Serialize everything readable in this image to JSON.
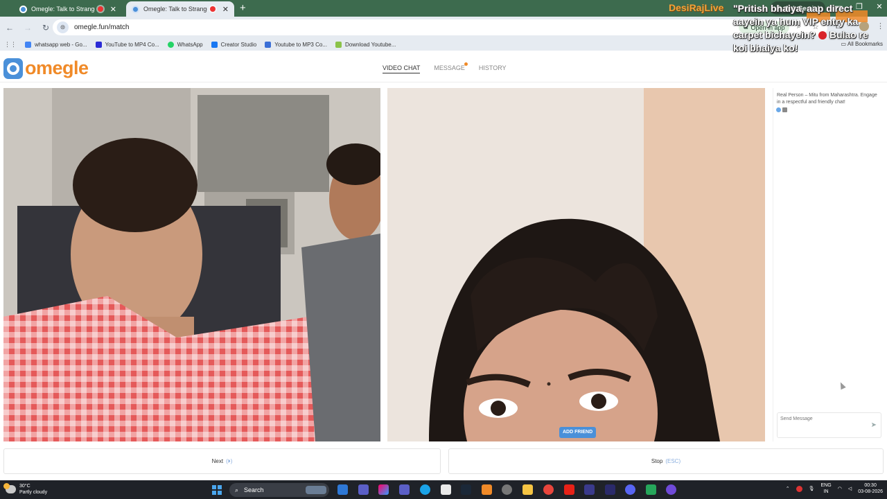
{
  "browser": {
    "tabs": [
      {
        "title": "Omegle: Talk to Strangers!",
        "recording": true,
        "active": false
      },
      {
        "title": "Omegle: Talk to Strangers!",
        "recording": true,
        "active": true
      }
    ],
    "new_tab": "+",
    "ask_gemini": "Ask Gemini",
    "url": "omegle.fun/match",
    "open_in_app": "Open in app",
    "bookmarks": [
      {
        "label": "whatsapp web - Go...",
        "color": "#4285f4"
      },
      {
        "label": "YouTube to MP4 Co...",
        "color": "#2b2bd6"
      },
      {
        "label": "WhatsApp",
        "color": "#25d366"
      },
      {
        "label": "Creator Studio",
        "color": "#1877f2"
      },
      {
        "label": "Youtube to MP3 Co...",
        "color": "#3b6fd6"
      },
      {
        "label": "Download Youtube...",
        "color": "#8bc34a"
      }
    ],
    "all_bookmarks": "All Bookmarks"
  },
  "site": {
    "logo_text": "omegle",
    "nav": [
      {
        "label": "VIDEO CHAT",
        "active": true
      },
      {
        "label": "MESSAGE",
        "active": false,
        "badge": true
      },
      {
        "label": "HISTORY",
        "active": false
      }
    ],
    "overlay": {
      "name": "DesiRajLive",
      "message_part1": "\"Pritish bhaiya, aap direct aayein ya hum VIP entry ka carpet bichayein?",
      "message_part2": "Bulao re koi bhaiya ko!"
    },
    "add_friend": "ADD FRIEND",
    "chat": {
      "info": "Real Person – Mitu from Maharashtra. Engage in a respectful and friendly chat!",
      "send_placeholder": "Send Message"
    },
    "next_label": "Next",
    "next_hint": "(⏵)",
    "stop_label": "Stop",
    "stop_hint": "(ESC)"
  },
  "taskbar": {
    "temperature": "30°C",
    "weather": "Partly cloudy",
    "search": "Search",
    "lang": "ENG",
    "region": "IN",
    "time": "00:30",
    "date": "03-08-2026"
  }
}
